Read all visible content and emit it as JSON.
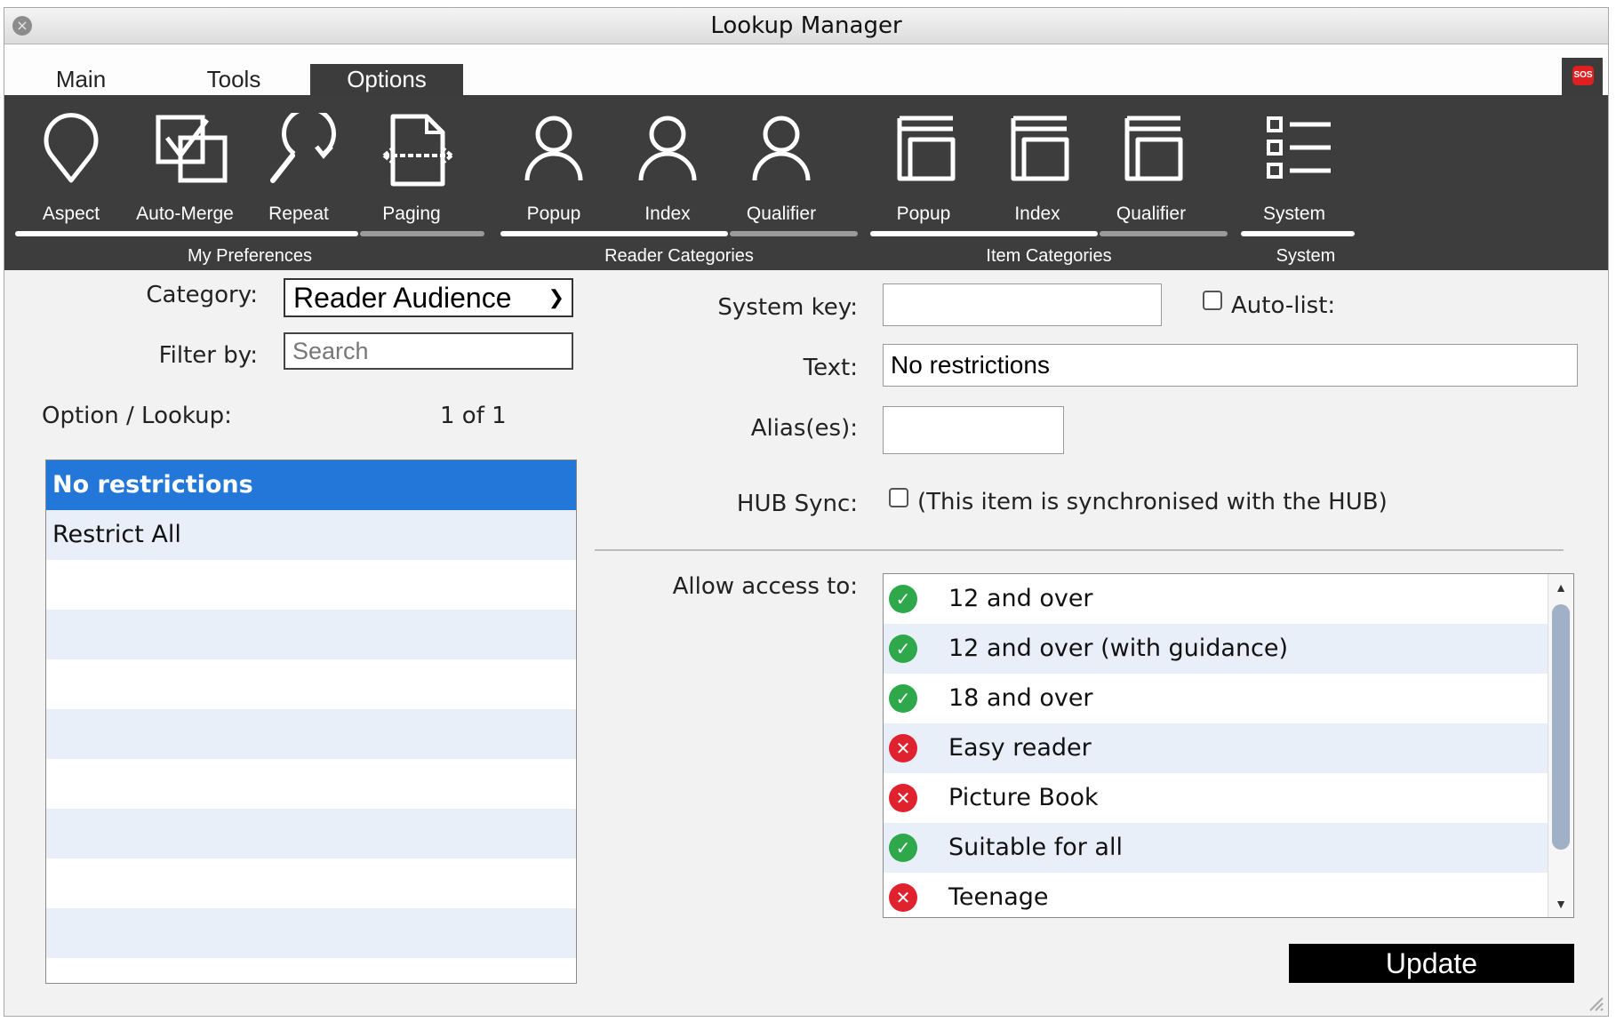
{
  "window": {
    "title": "Lookup Manager"
  },
  "tabs": [
    {
      "label": "Main",
      "active": false
    },
    {
      "label": "Tools",
      "active": false
    },
    {
      "label": "Options",
      "active": true
    }
  ],
  "sos_label": "SOS",
  "ribbon": {
    "tools": [
      {
        "label": "Aspect",
        "icon": "map-pin-icon"
      },
      {
        "label": "Auto-Merge",
        "icon": "merge-check-icon"
      },
      {
        "label": "Repeat",
        "icon": "repeat-search-icon"
      },
      {
        "label": "Paging",
        "icon": "paging-document-icon"
      },
      {
        "label": "Popup",
        "icon": "person-icon"
      },
      {
        "label": "Index",
        "icon": "person-icon"
      },
      {
        "label": "Qualifier",
        "icon": "person-icon"
      },
      {
        "label": "Popup",
        "icon": "item-box-icon"
      },
      {
        "label": "Index",
        "icon": "item-box-icon"
      },
      {
        "label": "Qualifier",
        "icon": "item-box-icon"
      },
      {
        "label": "System",
        "icon": "list-icon"
      }
    ],
    "groups": [
      "My Preferences",
      "Reader Categories",
      "Item Categories",
      "System"
    ]
  },
  "left": {
    "category_label": "Category:",
    "category_value": "Reader Audience",
    "filter_label": "Filter by:",
    "filter_placeholder": "Search",
    "option_label": "Option / Lookup:",
    "count": "1 of 1",
    "items": [
      "No restrictions",
      "Restrict All"
    ]
  },
  "right": {
    "system_key_label": "System key:",
    "system_key_value": "",
    "auto_list_label": "Auto-list:",
    "text_label": "Text:",
    "text_value": "No restrictions",
    "alias_label": "Alias(es):",
    "alias_value": "",
    "hub_sync_label": "HUB Sync:",
    "hub_sync_text": "(This item is synchronised with the HUB)",
    "allow_access_label": "Allow access to:",
    "access_items": [
      {
        "label": "12 and over",
        "allowed": true
      },
      {
        "label": "12 and over (with guidance)",
        "allowed": true
      },
      {
        "label": "18 and over",
        "allowed": true
      },
      {
        "label": "Easy reader",
        "allowed": false
      },
      {
        "label": "Picture Book",
        "allowed": false
      },
      {
        "label": "Suitable for all",
        "allowed": true
      },
      {
        "label": "Teenage",
        "allowed": false
      }
    ],
    "update_label": "Update"
  },
  "colors": {
    "ribbon": "#3d3d3d",
    "selection": "#2277d8",
    "allowed": "#2ea84a",
    "denied": "#e0222f"
  }
}
